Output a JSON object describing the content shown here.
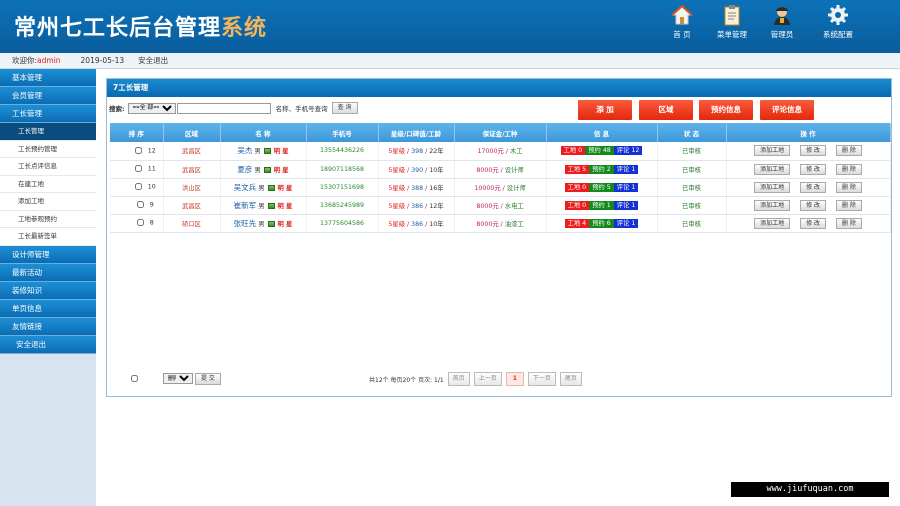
{
  "header": {
    "logo_main": "常州七工长后台管理",
    "logo_accent": "系统",
    "nav": [
      {
        "label": "首 页",
        "icon": "home-icon"
      },
      {
        "label": "菜单管理",
        "icon": "clipboard-icon"
      },
      {
        "label": "管理员",
        "icon": "admin-user-icon"
      },
      {
        "label": "系统配置",
        "icon": "gear-icon"
      }
    ]
  },
  "welcome": {
    "prefix": "欢迎你:",
    "username": "admin",
    "date": "2019-05-13",
    "logout": "安全退出"
  },
  "sidebar": {
    "items": [
      {
        "label": "基本管理",
        "type": "main"
      },
      {
        "label": "会员管理",
        "type": "main"
      },
      {
        "label": "工长管理",
        "type": "main"
      },
      {
        "label": "工长管理",
        "type": "sub",
        "active": true
      },
      {
        "label": "工长预约管理",
        "type": "sub"
      },
      {
        "label": "工长点评信息",
        "type": "sub"
      },
      {
        "label": "在建工地",
        "type": "sub"
      },
      {
        "label": "添加工地",
        "type": "sub"
      },
      {
        "label": "工地参观预约",
        "type": "sub"
      },
      {
        "label": "工长最新签单",
        "type": "sub"
      },
      {
        "label": "设计师管理",
        "type": "main"
      },
      {
        "label": "最新活动",
        "type": "main"
      },
      {
        "label": "装修知识",
        "type": "main"
      },
      {
        "label": "单页信息",
        "type": "main"
      },
      {
        "label": "友情链接",
        "type": "main"
      },
      {
        "label": "安全退出",
        "type": "main"
      }
    ]
  },
  "panel": {
    "title": "7工长管理",
    "search": {
      "label": "搜索:",
      "select_value": "==全 部==",
      "input_value": "",
      "hint": "名称、手机号查询",
      "button": "查 询"
    },
    "actions": {
      "add": "添 加",
      "region": "区域",
      "booking": "预约信息",
      "review": "评论信息"
    },
    "columns": [
      "排 序",
      "区域",
      "名 称",
      "手机号",
      "星级/口碑值/工龄",
      "保证金/工种",
      "信 息",
      "状 态",
      "操 作"
    ],
    "rows": [
      {
        "sort": "12",
        "area": "武昌区",
        "name": "吴杰",
        "gender": "男",
        "badge": "明 星",
        "phone": "13554436226",
        "star": "5星级",
        "rep": "398",
        "years": "22年",
        "deposit": "17000元",
        "trade": "木工",
        "sites": "工地 0",
        "bookings": "预约 48",
        "reviews": "评论 12",
        "status": "已审核"
      },
      {
        "sort": "11",
        "area": "武昌区",
        "name": "夏彦",
        "gender": "男",
        "badge": "明 星",
        "phone": "18907118568",
        "star": "5星级",
        "rep": "390",
        "years": "10年",
        "deposit": "8000元",
        "trade": "设计师",
        "sites": "工地 5",
        "bookings": "预约 2",
        "reviews": "评论 1",
        "status": "已审核"
      },
      {
        "sort": "10",
        "area": "洪山区",
        "name": "吴文兵",
        "gender": "男",
        "badge": "明 星",
        "phone": "15307151698",
        "star": "5星级",
        "rep": "388",
        "years": "16年",
        "deposit": "10000元",
        "trade": "设计师",
        "sites": "工地 0",
        "bookings": "预约 5",
        "reviews": "评论 1",
        "status": "已审核"
      },
      {
        "sort": "9",
        "area": "武昌区",
        "name": "崔新军",
        "gender": "男",
        "badge": "明 星",
        "phone": "13685245989",
        "star": "5星级",
        "rep": "386",
        "years": "12年",
        "deposit": "8000元",
        "trade": "水电工",
        "sites": "工地 0",
        "bookings": "预约 1",
        "reviews": "评论 1",
        "status": "已审核"
      },
      {
        "sort": "8",
        "area": "硚口区",
        "name": "张旺先",
        "gender": "男",
        "badge": "明 星",
        "phone": "13775604586",
        "star": "5星级",
        "rep": "386",
        "years": "10年",
        "deposit": "8000元",
        "trade": "油漆工",
        "sites": "工地 4",
        "bookings": "预约 6",
        "reviews": "评论 1",
        "status": "已审核"
      }
    ],
    "row_ops": [
      "添加工地",
      "修 改",
      "删 除"
    ],
    "footer": {
      "bulk_select": "删除",
      "bulk_button": "提 交",
      "pager_info": "共12个 每页20个 页次: 1/1",
      "first": "首页",
      "prev": "上一页",
      "current": "1",
      "next": "下一页",
      "last": "尾页"
    }
  },
  "watermark": "www.jiufuquan.com"
}
